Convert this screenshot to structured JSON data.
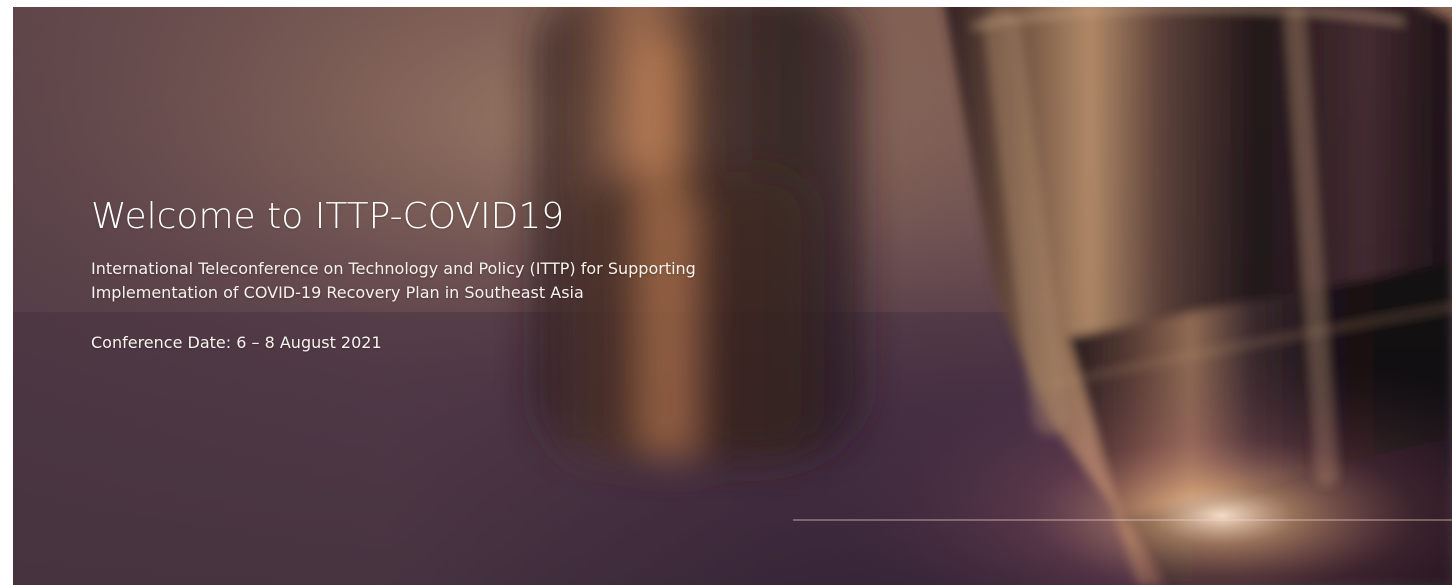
{
  "hero": {
    "title": "Welcome to ITTP-COVID19",
    "subtitle": "International Teleconference on Technology and Policy (ITTP) for Supporting Implementation of COVID-19 Recovery Plan in Southeast Asia",
    "conference_date": "Conference Date: 6 – 8 August 2021",
    "background_image": "microscope-objective-lens-photo",
    "colors": {
      "overlay_warm": "#8a6654",
      "overlay_dark": "#2f1f33",
      "text": "#ffffff"
    }
  }
}
